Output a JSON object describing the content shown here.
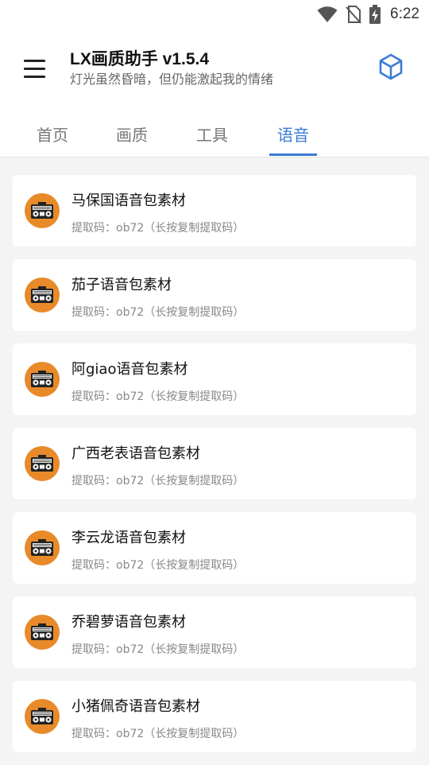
{
  "status_bar": {
    "time": "6:22",
    "icons": [
      "wifi-icon",
      "no-sim-icon",
      "battery-charging-icon"
    ]
  },
  "app_bar": {
    "menu_icon": "menu-icon",
    "title": "LX画质助手 v1.5.4",
    "subtitle": "灯光虽然昏暗，但仍能激起我的情绪",
    "action_icon": "cube-icon",
    "accent_color": "#3a7bd5"
  },
  "tabs": [
    {
      "label": "首页",
      "active": false
    },
    {
      "label": "画质",
      "active": false
    },
    {
      "label": "工具",
      "active": false
    },
    {
      "label": "语音",
      "active": true
    }
  ],
  "items": [
    {
      "title": "马保国语音包素材",
      "subtitle": "提取码：ob72（长按复制提取码）",
      "icon": "radio-icon"
    },
    {
      "title": "茄子语音包素材",
      "subtitle": "提取码：ob72（长按复制提取码）",
      "icon": "radio-icon"
    },
    {
      "title": "阿giao语音包素材",
      "subtitle": "提取码：ob72（长按复制提取码）",
      "icon": "radio-icon"
    },
    {
      "title": "广西老表语音包素材",
      "subtitle": "提取码：ob72（长按复制提取码）",
      "icon": "radio-icon"
    },
    {
      "title": "李云龙语音包素材",
      "subtitle": "提取码：ob72（长按复制提取码）",
      "icon": "radio-icon"
    },
    {
      "title": "乔碧萝语音包素材",
      "subtitle": "提取码：ob72（长按复制提取码）",
      "icon": "radio-icon"
    },
    {
      "title": "小猪佩奇语音包素材",
      "subtitle": "提取码：ob72（长按复制提取码）",
      "icon": "radio-icon"
    }
  ]
}
